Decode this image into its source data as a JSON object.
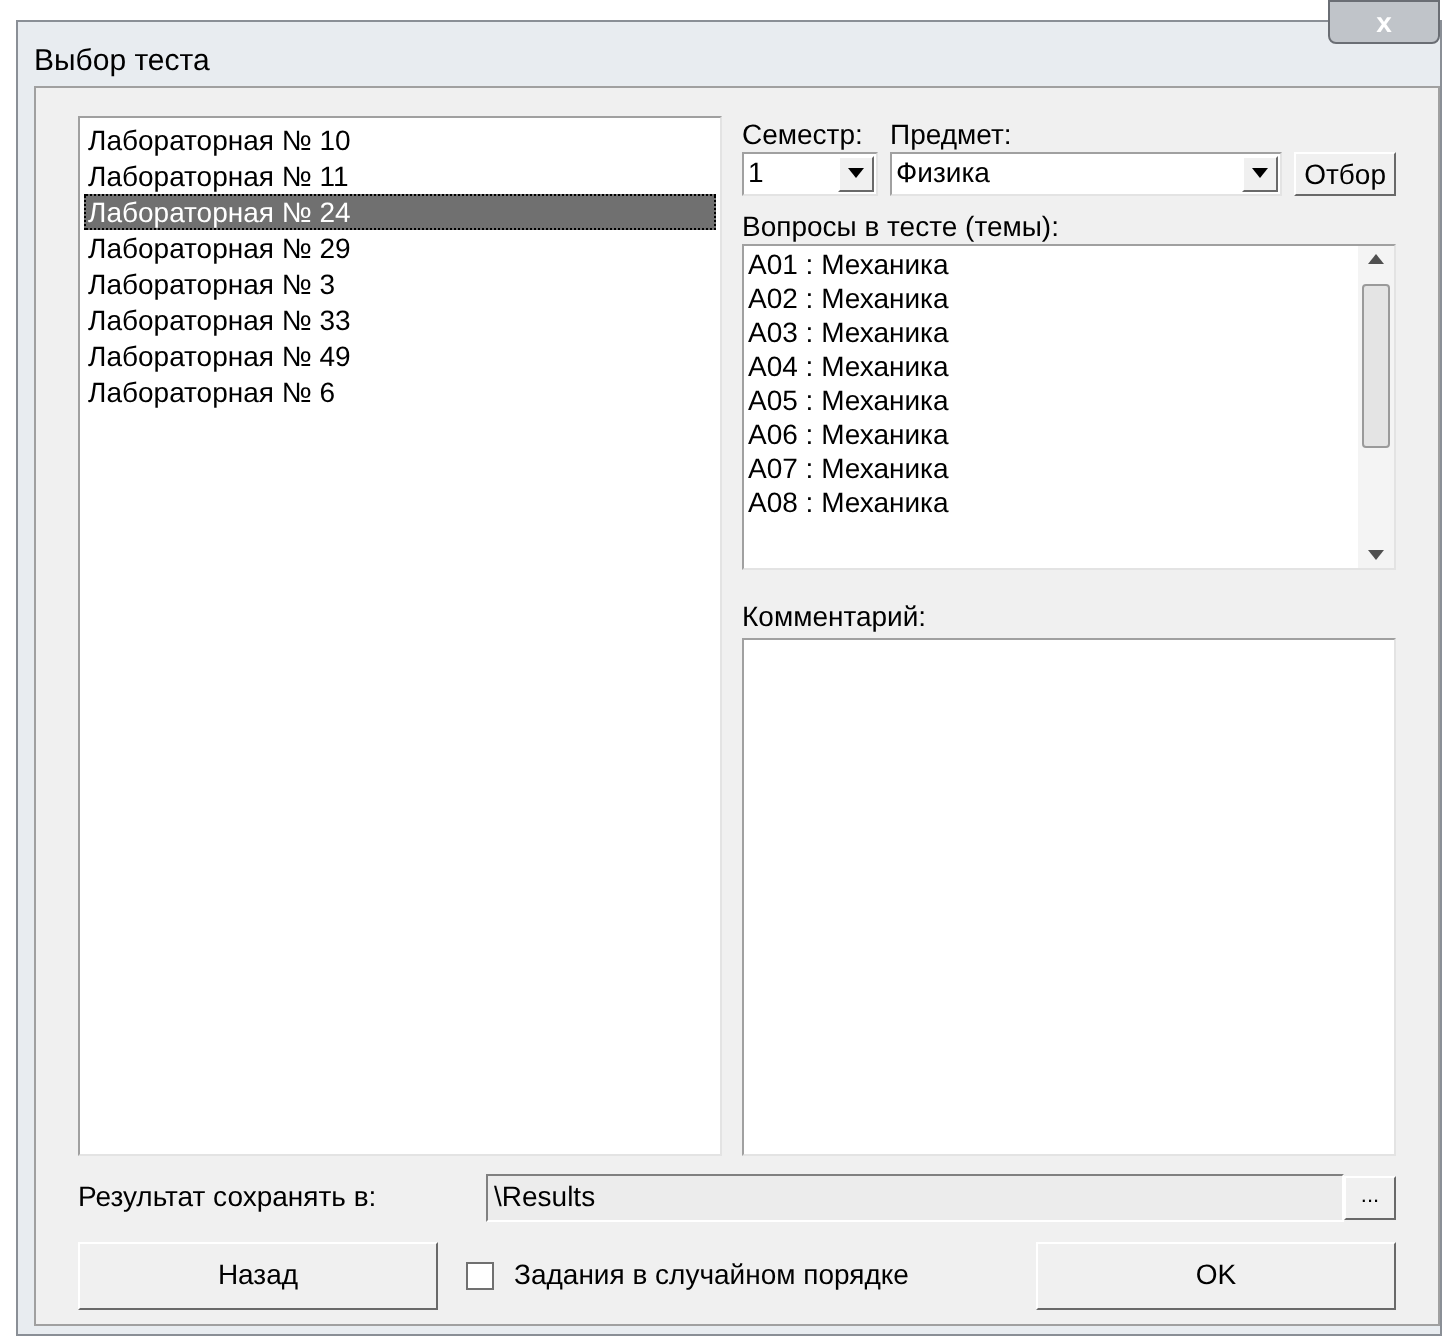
{
  "window": {
    "title": "Выбор теста",
    "close": "x"
  },
  "labs": [
    {
      "label": "Лабораторная № 10",
      "selected": false
    },
    {
      "label": "Лабораторная № 11",
      "selected": false
    },
    {
      "label": "Лабораторная № 24",
      "selected": true
    },
    {
      "label": "Лабораторная № 29",
      "selected": false
    },
    {
      "label": "Лабораторная № 3",
      "selected": false
    },
    {
      "label": "Лабораторная № 33",
      "selected": false
    },
    {
      "label": "Лабораторная № 49",
      "selected": false
    },
    {
      "label": "Лабораторная № 6",
      "selected": false
    }
  ],
  "semester": {
    "label": "Семестр:",
    "value": "1"
  },
  "subject": {
    "label": "Предмет:",
    "value": "Физика"
  },
  "filter_button": "Отбор",
  "questions": {
    "label": "Вопросы в тесте (темы):",
    "items": [
      "A01 : Механика",
      "A02 : Механика",
      "A03 : Механика",
      "A04 : Механика",
      "A05 : Механика",
      "A06 : Механика",
      "A07 : Механика",
      "A08 : Механика"
    ]
  },
  "comment": {
    "label": "Комментарий:"
  },
  "results": {
    "label": "Результат сохранять в:",
    "value": "\\Results",
    "browse": "..."
  },
  "back_button": "Назад",
  "random_order": {
    "label": "Задания в случайном порядке",
    "checked": false
  },
  "ok_button": "OK"
}
